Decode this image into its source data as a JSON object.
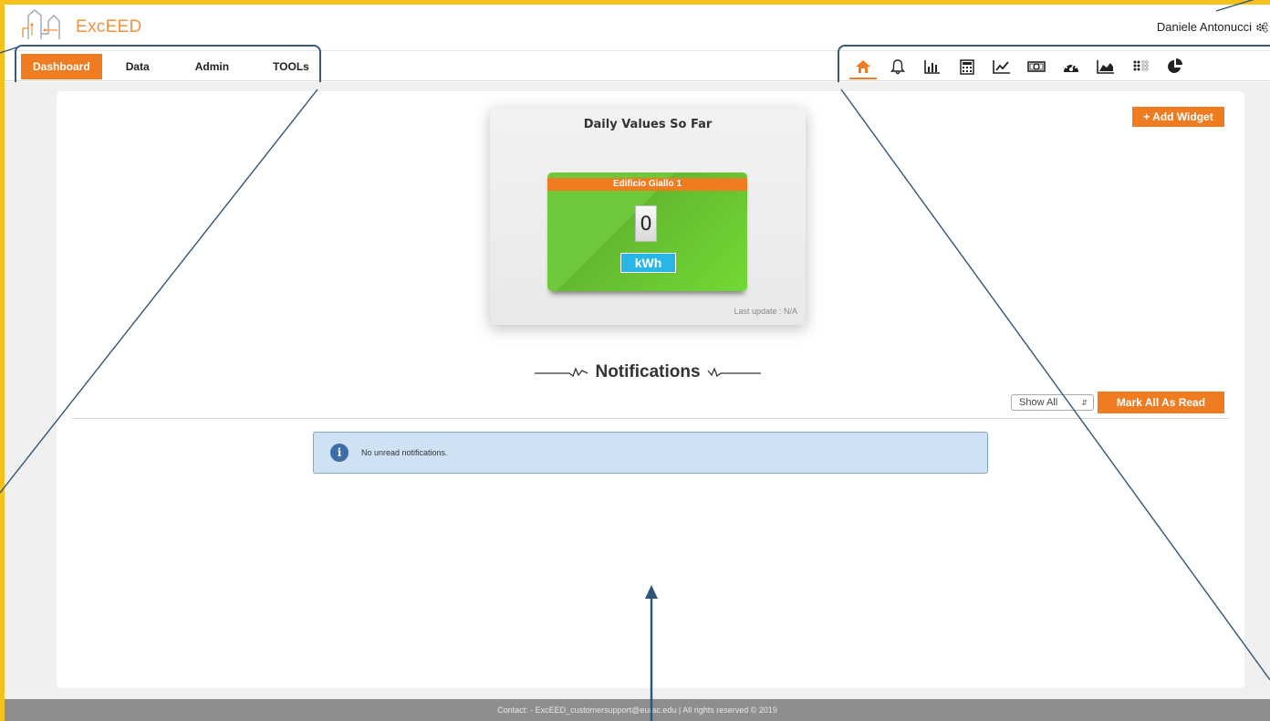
{
  "header": {
    "logo_text": "ExcEED",
    "user_name": "Daniele Antonucci"
  },
  "nav": {
    "tabs": [
      {
        "label": "Dashboard",
        "active": true
      },
      {
        "label": "Data",
        "active": false
      },
      {
        "label": "Admin",
        "active": false
      },
      {
        "label": "TOOLs",
        "active": false
      }
    ],
    "icon_bar": [
      "home-icon",
      "bell-icon",
      "bar-chart-icon",
      "calculator-icon",
      "line-chart-icon",
      "money-icon",
      "dashboard-gauge-icon",
      "area-chart-icon",
      "dots-grid-icon",
      "pie-chart-icon"
    ]
  },
  "main": {
    "add_widget_label": "+ Add Widget",
    "widget": {
      "title": "Daily Values So Far",
      "building": "Edificio Giallo 1",
      "value": "0",
      "unit": "kWh",
      "last_update": "Last update : N/A"
    },
    "notifications": {
      "title": "Notifications",
      "filter_value": "Show All",
      "mark_all_label": "Mark All As Read",
      "empty_message": "No unread notifications."
    }
  },
  "footer": {
    "text": "Contact: - ExcEED_customersupport@eurac.edu | All rights reserved © 2019"
  },
  "colors": {
    "accent": "#f07c22",
    "frame": "#f5c11a",
    "callout": "#3a5a7a",
    "card_green": "#6ec83a",
    "unit_blue": "#29b6e6"
  }
}
